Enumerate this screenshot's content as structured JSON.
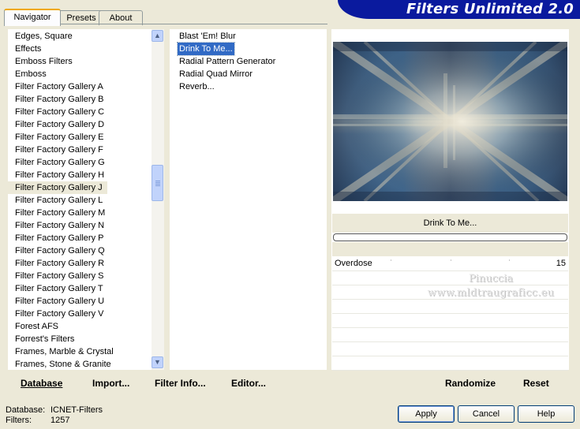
{
  "window": {
    "title": "Filters Unlimited 2.0"
  },
  "tabs": [
    {
      "label": "Navigator",
      "active": true
    },
    {
      "label": "Presets",
      "active": false
    },
    {
      "label": "About",
      "active": false
    }
  ],
  "categories": {
    "items": [
      "Edges, Square",
      "Effects",
      "Emboss Filters",
      "Emboss",
      "Filter Factory Gallery A",
      "Filter Factory Gallery B",
      "Filter Factory Gallery C",
      "Filter Factory Gallery D",
      "Filter Factory Gallery E",
      "Filter Factory Gallery F",
      "Filter Factory Gallery G",
      "Filter Factory Gallery H",
      "Filter Factory Gallery J",
      "Filter Factory Gallery L",
      "Filter Factory Gallery M",
      "Filter Factory Gallery N",
      "Filter Factory Gallery P",
      "Filter Factory Gallery Q",
      "Filter Factory Gallery R",
      "Filter Factory Gallery S",
      "Filter Factory Gallery T",
      "Filter Factory Gallery U",
      "Filter Factory Gallery V",
      "Forest AFS",
      "Forrest's Filters",
      "Frames, Marble & Crystal",
      "Frames, Stone & Granite"
    ],
    "selected": "Filter Factory Gallery J"
  },
  "filters": {
    "items": [
      "Blast 'Em! Blur",
      "Drink To Me...",
      "Radial Pattern Generator",
      "Radial Quad Mirror",
      "Reverb..."
    ],
    "selected": "Drink To Me..."
  },
  "preview": {
    "filter_name": "Drink To Me...",
    "progress": 0
  },
  "parameters": [
    {
      "label": "Overdose",
      "value": "15"
    }
  ],
  "watermark": {
    "line1": "Pinuccia",
    "line2": "www.mldtraugraficc.eu"
  },
  "toolbar": {
    "database_label": "Database",
    "import_label": "Import...",
    "filter_info_label": "Filter Info...",
    "editor_label": "Editor...",
    "randomize_label": "Randomize",
    "reset_label": "Reset"
  },
  "status": {
    "database_label": "Database:",
    "database_value": "ICNET-Filters",
    "filters_label": "Filters:",
    "filters_value": "1257"
  },
  "buttons": {
    "apply": "Apply",
    "cancel": "Cancel",
    "help": "Help"
  },
  "colors": {
    "header_bg": "#0a1a9e",
    "selection": "#316ac5",
    "window_bg": "#ece9d8"
  }
}
